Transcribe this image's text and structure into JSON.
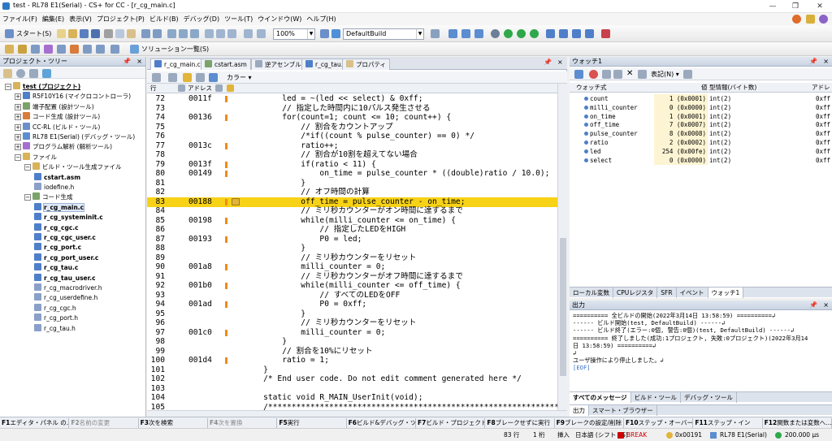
{
  "window": {
    "title": "test - RL78 E1(Serial) - CS+ for CC - [r_cg_main.c]",
    "controls": [
      "—",
      "❐",
      "✕"
    ]
  },
  "menu": [
    "ファイル(F)",
    "編集(E)",
    "表示(V)",
    "プロジェクト(P)",
    "ビルド(B)",
    "デバッグ(D)",
    "ツール(T)",
    "ウインドウ(W)",
    "ヘルプ(H)"
  ],
  "toolbar1": {
    "start_label": "スタート(S)",
    "zoom": "100%",
    "build_config": "DefaultBuild"
  },
  "toolbar2": {
    "solution_label": "ソリューション一覧(S)"
  },
  "project_tree": {
    "title": "プロジェクト・ツリー",
    "items": [
      {
        "label": "test (プロジェクト)",
        "level": 0,
        "bold": true
      },
      {
        "label": "R5F10Y16 (マイクロコントローラ)",
        "level": 1,
        "bold": false
      },
      {
        "label": "端子配置 (設計ツール)",
        "level": 1,
        "bold": false
      },
      {
        "label": "コード生成 (設計ツール)",
        "level": 1,
        "bold": false
      },
      {
        "label": "CC-RL (ビルド・ツール)",
        "level": 1,
        "bold": false
      },
      {
        "label": "RL78 E1(Serial) (デバッグ・ツール)",
        "level": 1,
        "bold": false
      },
      {
        "label": "プログラム解析 (解析ツール)",
        "level": 1,
        "bold": false
      },
      {
        "label": "ファイル",
        "level": 1,
        "bold": false
      },
      {
        "label": "ビルド・ツール生成ファイル",
        "level": 2,
        "bold": false
      },
      {
        "label": "cstart.asm",
        "level": 3,
        "bold": true
      },
      {
        "label": "iodefine.h",
        "level": 3,
        "bold": false
      },
      {
        "label": "コード生成",
        "level": 2,
        "bold": false
      },
      {
        "label": "r_cg_main.c",
        "level": 3,
        "bold": true
      },
      {
        "label": "r_cg_systeminit.c",
        "level": 3,
        "bold": true
      },
      {
        "label": "r_cg_cgc.c",
        "level": 3,
        "bold": true
      },
      {
        "label": "r_cg_cgc_user.c",
        "level": 3,
        "bold": true
      },
      {
        "label": "r_cg_port.c",
        "level": 3,
        "bold": true
      },
      {
        "label": "r_cg_port_user.c",
        "level": 3,
        "bold": true
      },
      {
        "label": "r_cg_tau.c",
        "level": 3,
        "bold": true
      },
      {
        "label": "r_cg_tau_user.c",
        "level": 3,
        "bold": true
      },
      {
        "label": "r_cg_macrodriver.h",
        "level": 3,
        "bold": false
      },
      {
        "label": "r_cg_userdefine.h",
        "level": 3,
        "bold": false
      },
      {
        "label": "r_cg_cgc.h",
        "level": 3,
        "bold": false
      },
      {
        "label": "r_cg_port.h",
        "level": 3,
        "bold": false
      },
      {
        "label": "r_cg_tau.h",
        "level": 3,
        "bold": false
      }
    ]
  },
  "editor": {
    "tabs": [
      "r_cg_main.c",
      "cstart.asm",
      "逆アセンブル1",
      "r_cg_tau.c",
      "プロパティ"
    ],
    "columns": {
      "line": "行",
      "address": "アドレス"
    },
    "color_menu": "カラー",
    "lines": [
      {
        "n": "72",
        "addr": "0011f",
        "mark": true,
        "code": "        led = ~(led << select) & 0xff;",
        "cls": ""
      },
      {
        "n": "73",
        "addr": "",
        "mark": false,
        "code": "        // 指定した時間内に10パルス発生させる",
        "cls": "com"
      },
      {
        "n": "74",
        "addr": "00136",
        "mark": true,
        "code": "        for(count=1; count <= 10; count++) {",
        "cls": ""
      },
      {
        "n": "75",
        "addr": "",
        "mark": false,
        "code": "            // 割合をカウントアップ",
        "cls": "com"
      },
      {
        "n": "76",
        "addr": "",
        "mark": false,
        "code": "            /*if((count % pulse_counter) == 0) */",
        "cls": "com"
      },
      {
        "n": "77",
        "addr": "0013c",
        "mark": true,
        "code": "            ratio++;",
        "cls": ""
      },
      {
        "n": "78",
        "addr": "",
        "mark": false,
        "code": "            // 割合が10割を超えてない場合",
        "cls": "com"
      },
      {
        "n": "79",
        "addr": "0013f",
        "mark": true,
        "code": "            if(ratio < 11) {",
        "cls": ""
      },
      {
        "n": "80",
        "addr": "00149",
        "mark": true,
        "code": "                on_time = pulse_counter * ((double)ratio / 10.0);",
        "cls": ""
      },
      {
        "n": "81",
        "addr": "",
        "mark": false,
        "code": "            }",
        "cls": ""
      },
      {
        "n": "82",
        "addr": "",
        "mark": false,
        "code": "            // オフ時間の計算",
        "cls": "com"
      },
      {
        "n": "83",
        "addr": "00188",
        "mark": true,
        "code": "            off_time = pulse_counter - on_time;",
        "cls": "",
        "hl": true
      },
      {
        "n": "84",
        "addr": "",
        "mark": false,
        "code": "            // ミリ秒カウンターがオン時間に達するまで",
        "cls": "com"
      },
      {
        "n": "85",
        "addr": "00198",
        "mark": true,
        "code": "            while(milli_counter <= on_time) {",
        "cls": ""
      },
      {
        "n": "86",
        "addr": "",
        "mark": false,
        "code": "                // 指定したLEDをHIGH",
        "cls": "com"
      },
      {
        "n": "87",
        "addr": "00193",
        "mark": true,
        "code": "                P0 = led;",
        "cls": ""
      },
      {
        "n": "88",
        "addr": "",
        "mark": false,
        "code": "            }",
        "cls": ""
      },
      {
        "n": "89",
        "addr": "",
        "mark": false,
        "code": "            // ミリ秒カウンターをリセット",
        "cls": "com"
      },
      {
        "n": "90",
        "addr": "001a8",
        "mark": true,
        "code": "            milli_counter = 0;",
        "cls": ""
      },
      {
        "n": "91",
        "addr": "",
        "mark": false,
        "code": "            // ミリ秒カウンターがオフ時間に達するまで",
        "cls": "com"
      },
      {
        "n": "92",
        "addr": "001b0",
        "mark": true,
        "code": "            while(milli_counter <= off_time) {",
        "cls": ""
      },
      {
        "n": "93",
        "addr": "",
        "mark": false,
        "code": "                // すべてのLEDをOFF",
        "cls": "com"
      },
      {
        "n": "94",
        "addr": "001ad",
        "mark": true,
        "code": "                P0 = 0xff;",
        "cls": ""
      },
      {
        "n": "95",
        "addr": "",
        "mark": false,
        "code": "            }",
        "cls": ""
      },
      {
        "n": "96",
        "addr": "",
        "mark": false,
        "code": "            // ミリ秒カウンターをリセット",
        "cls": "com"
      },
      {
        "n": "97",
        "addr": "001c0",
        "mark": true,
        "code": "            milli_counter = 0;",
        "cls": ""
      },
      {
        "n": "98",
        "addr": "",
        "mark": false,
        "code": "        }",
        "cls": ""
      },
      {
        "n": "99",
        "addr": "",
        "mark": false,
        "code": "        // 割合を10%にリセット",
        "cls": "com"
      },
      {
        "n": "100",
        "addr": "001d4",
        "mark": true,
        "code": "        ratio = 1;",
        "cls": ""
      },
      {
        "n": "101",
        "addr": "",
        "mark": false,
        "code": "    }",
        "cls": ""
      },
      {
        "n": "102",
        "addr": "",
        "mark": false,
        "code": "    /* End user code. Do not edit comment generated here */",
        "cls": ""
      },
      {
        "n": "103",
        "addr": "",
        "mark": false,
        "code": "",
        "cls": ""
      },
      {
        "n": "104",
        "addr": "",
        "mark": false,
        "code": "    static void R_MAIN_UserInit(void);",
        "cls": ""
      },
      {
        "n": "105",
        "addr": "",
        "mark": false,
        "code": "    /*********************************************************************",
        "cls": "com"
      }
    ]
  },
  "watch": {
    "title": "ウォッチ1",
    "notation": "表記(N)",
    "headers": {
      "expr": "ウォッチ式",
      "value": "値",
      "type": "型情報(バイト数)",
      "addr": "アドレ"
    },
    "rows": [
      {
        "name": "count",
        "value": "1 (0x0001)",
        "type": "int(2)",
        "addr": "0xff"
      },
      {
        "name": "milli_counter",
        "value": "0 (0x0000)",
        "type": "int(2)",
        "addr": "0xff"
      },
      {
        "name": "on_time",
        "value": "1 (0x0001)",
        "type": "int(2)",
        "addr": "0xff"
      },
      {
        "name": "off_time",
        "value": "7 (0x0007)",
        "type": "int(2)",
        "addr": "0xff"
      },
      {
        "name": "pulse_counter",
        "value": "8 (0x0008)",
        "type": "int(2)",
        "addr": "0xff"
      },
      {
        "name": "ratio",
        "value": "2 (0x0002)",
        "type": "int(2)",
        "addr": "0xff"
      },
      {
        "name": "led",
        "value": "254 (0x00fe)",
        "type": "int(2)",
        "addr": "0xff"
      },
      {
        "name": "select",
        "value": "0 (0x0000)",
        "type": "int(2)",
        "addr": "0xff"
      }
    ],
    "bottom_tabs": [
      "ローカル変数",
      "CPUレジスタ",
      "SFR",
      "イベント",
      "ウォッチ1"
    ]
  },
  "output": {
    "title": "出力",
    "lines": [
      "========== 全ビルドの開始(2022年3月14日 13:58:59) ==========↲",
      "------ ビルド開始(test, DefaultBuild) ------↲",
      "------ ビルド終了(エラー:0個, 警告:0個)(test, DefaultBuild) ------↲",
      "========== 終了しました(成功:1プロジェクト, 失敗:0プロジェクト)(2022年3月14",
      "日 13:58:59) ==========↲",
      "↲",
      "ユーザ操作により停止しました。↲",
      "[EOF]"
    ],
    "tabs": [
      "すべてのメッセージ",
      "ビルド・ツール",
      "デバッグ・ツール"
    ],
    "lower_tabs": [
      "出力",
      "スマート・ブラウザー"
    ]
  },
  "fkeys": [
    {
      "key": "F1",
      "label": "エディタ・パネル の…",
      "dim": false
    },
    {
      "key": "F2",
      "label": "名前の変更",
      "dim": true
    },
    {
      "key": "F3",
      "label": "次を検索",
      "dim": false
    },
    {
      "key": "F4",
      "label": "次を置換",
      "dim": true
    },
    {
      "key": "F5",
      "label": "実行",
      "dim": false
    },
    {
      "key": "F6",
      "label": "ビルド&デバッグ・ツ…",
      "dim": false
    },
    {
      "key": "F7",
      "label": "ビルド・プロジェクト",
      "dim": false
    },
    {
      "key": "F8",
      "label": "ブレークせずに実行",
      "dim": false
    },
    {
      "key": "F9",
      "label": "ブレークの設定/削除",
      "dim": false
    },
    {
      "key": "F10",
      "label": "ステップ・オーバー",
      "dim": false
    },
    {
      "key": "F11",
      "label": "ステップ・イン",
      "dim": false
    },
    {
      "key": "F12",
      "label": "関数または変数へ…",
      "dim": false
    }
  ],
  "status": {
    "line": "83 行",
    "col": "1 桁",
    "mode": "挿入",
    "encoding": "日本語 (シフト JIS)",
    "state": "BREAK",
    "pc": "0x00191",
    "debugger": "RL78 E1(Serial)",
    "time": "200.000 μs"
  },
  "colors": {
    "accent": "#2b79c2",
    "highlight": "#f7d216",
    "comment": "#1c8c1c",
    "break": "#cc0000"
  }
}
